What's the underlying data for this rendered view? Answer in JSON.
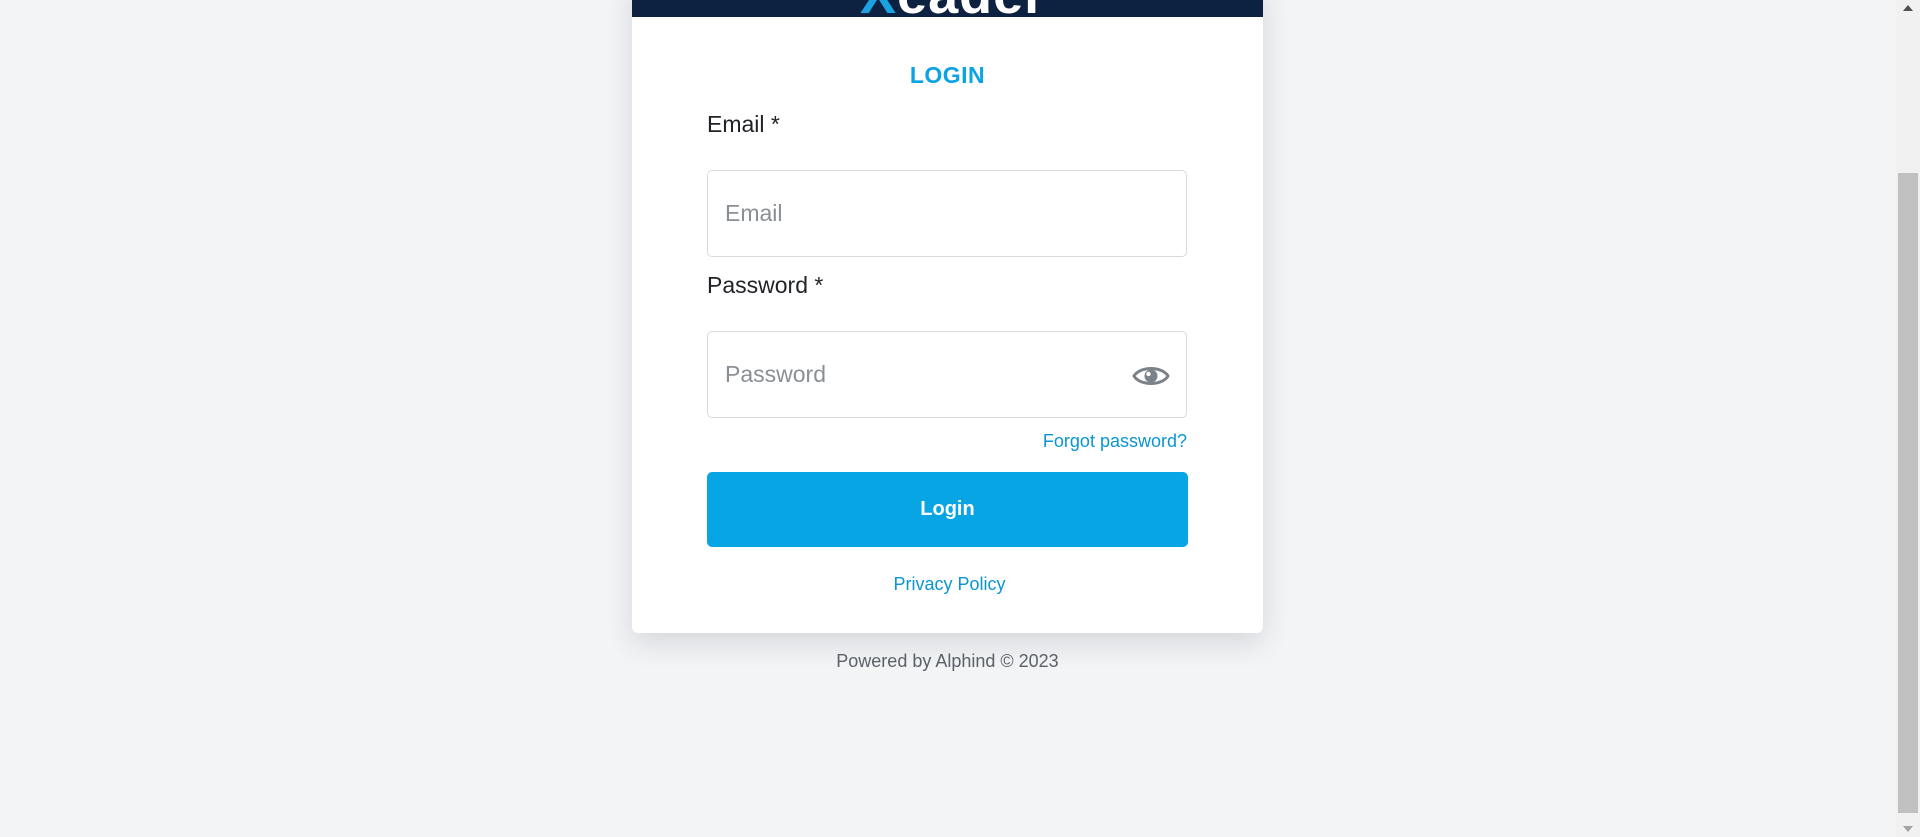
{
  "brand": {
    "logo_text_accent": "X",
    "logo_text_rest": "eader",
    "header_color": "#0d2240",
    "accent_color": "#08a5e4"
  },
  "login_form": {
    "heading": "LOGIN",
    "email_label": "Email *",
    "email_placeholder": "Email",
    "email_value": "",
    "password_label": "Password *",
    "password_placeholder": "Password",
    "password_value": "",
    "password_toggle_icon": "eye-icon",
    "forgot_password": "Forgot password?",
    "submit_label": "Login",
    "privacy_policy": "Privacy Policy"
  },
  "footer": {
    "text": "Powered by Alphind © 2023"
  },
  "scrollbar": {
    "up_icon": "scroll-up-arrow-icon",
    "down_icon": "scroll-down-arrow-icon"
  }
}
